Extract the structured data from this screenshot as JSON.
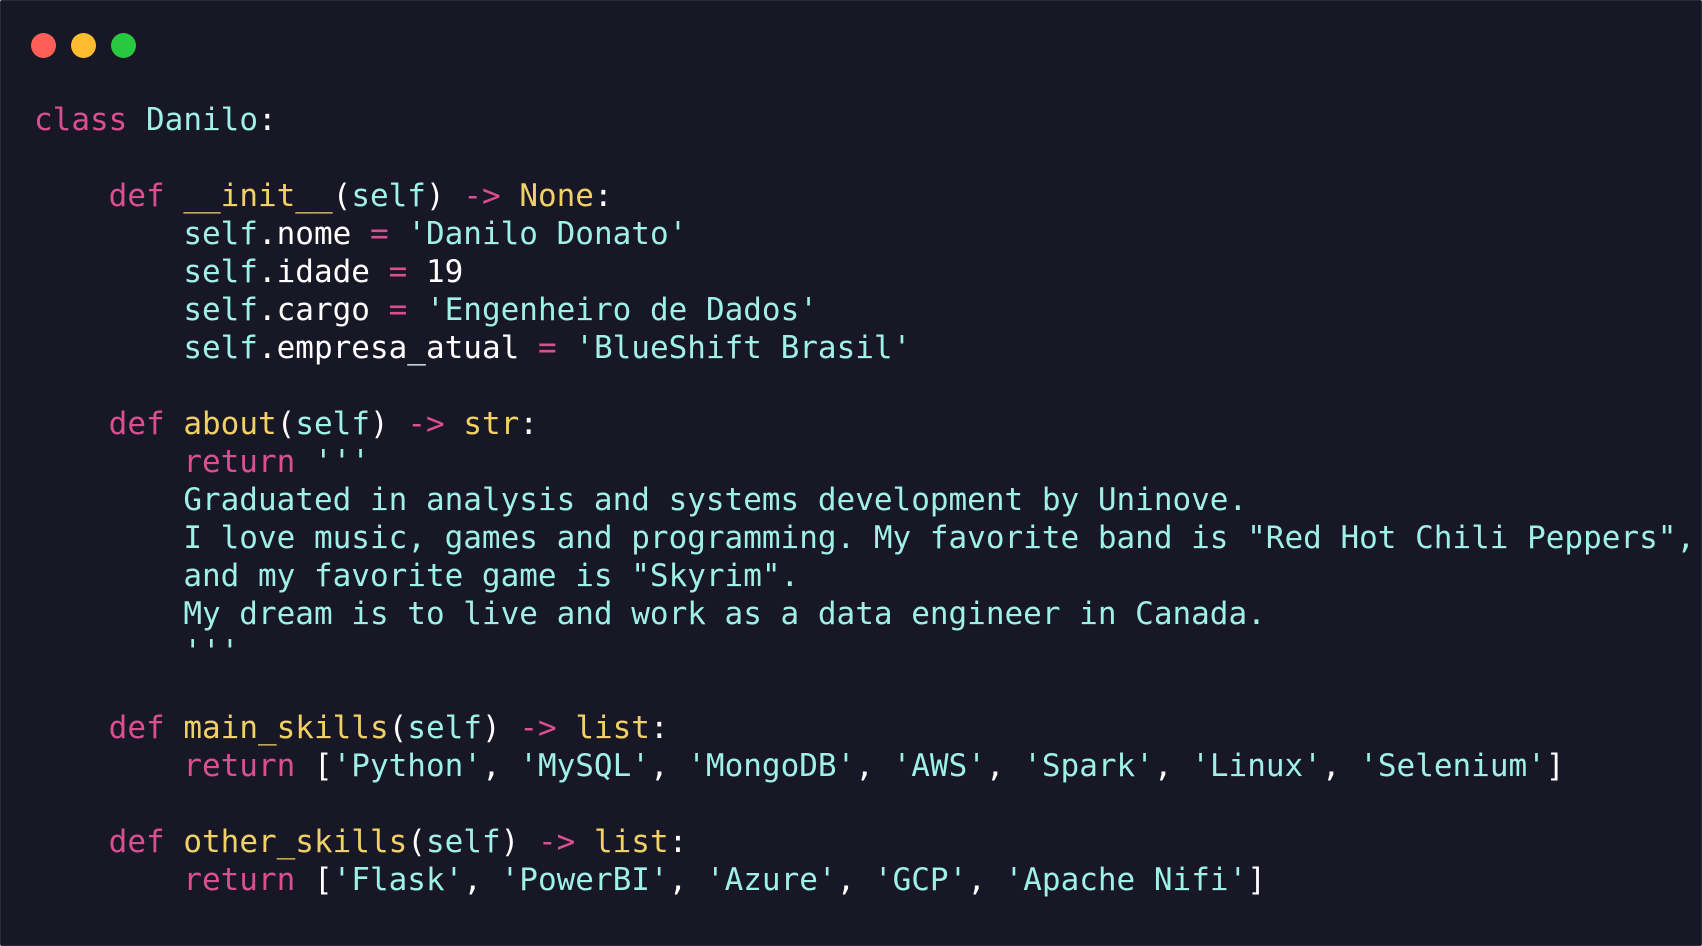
{
  "window": {
    "traffic_lights": [
      {
        "name": "close",
        "color": "#ff5f57"
      },
      {
        "name": "minimize",
        "color": "#febc2e"
      },
      {
        "name": "maximize",
        "color": "#28c840"
      }
    ]
  },
  "colors": {
    "background": "#171726",
    "keyword": "#d94f92",
    "function": "#f1d066",
    "text": "#9ff0e6",
    "punctuation": "#ffffff"
  },
  "code": {
    "language": "python",
    "lines": [
      [
        {
          "t": "keyword",
          "v": "class"
        },
        {
          "t": "text",
          "v": " "
        },
        {
          "t": "name",
          "v": "Danilo"
        },
        {
          "t": "punct",
          "v": ":"
        }
      ],
      [],
      [
        {
          "t": "text",
          "v": "    "
        },
        {
          "t": "keyword",
          "v": "def"
        },
        {
          "t": "text",
          "v": " "
        },
        {
          "t": "func",
          "v": "__init__"
        },
        {
          "t": "punct",
          "v": "("
        },
        {
          "t": "name",
          "v": "self"
        },
        {
          "t": "punct",
          "v": ")"
        },
        {
          "t": "text",
          "v": " "
        },
        {
          "t": "op",
          "v": "->"
        },
        {
          "t": "text",
          "v": " "
        },
        {
          "t": "type",
          "v": "None"
        },
        {
          "t": "punct",
          "v": ":"
        }
      ],
      [
        {
          "t": "text",
          "v": "        "
        },
        {
          "t": "name",
          "v": "self"
        },
        {
          "t": "punct",
          "v": "."
        },
        {
          "t": "punct",
          "v": "nome"
        },
        {
          "t": "text",
          "v": " "
        },
        {
          "t": "op",
          "v": "="
        },
        {
          "t": "text",
          "v": " "
        },
        {
          "t": "string",
          "v": "'Danilo Donato'"
        }
      ],
      [
        {
          "t": "text",
          "v": "        "
        },
        {
          "t": "name",
          "v": "self"
        },
        {
          "t": "punct",
          "v": "."
        },
        {
          "t": "punct",
          "v": "idade"
        },
        {
          "t": "text",
          "v": " "
        },
        {
          "t": "op",
          "v": "="
        },
        {
          "t": "text",
          "v": " "
        },
        {
          "t": "number",
          "v": "19"
        }
      ],
      [
        {
          "t": "text",
          "v": "        "
        },
        {
          "t": "name",
          "v": "self"
        },
        {
          "t": "punct",
          "v": "."
        },
        {
          "t": "punct",
          "v": "cargo"
        },
        {
          "t": "text",
          "v": " "
        },
        {
          "t": "op",
          "v": "="
        },
        {
          "t": "text",
          "v": " "
        },
        {
          "t": "string",
          "v": "'Engenheiro de Dados'"
        }
      ],
      [
        {
          "t": "text",
          "v": "        "
        },
        {
          "t": "name",
          "v": "self"
        },
        {
          "t": "punct",
          "v": "."
        },
        {
          "t": "punct",
          "v": "empresa_atual"
        },
        {
          "t": "text",
          "v": " "
        },
        {
          "t": "op",
          "v": "="
        },
        {
          "t": "text",
          "v": " "
        },
        {
          "t": "string",
          "v": "'BlueShift Brasil'"
        }
      ],
      [],
      [
        {
          "t": "text",
          "v": "    "
        },
        {
          "t": "keyword",
          "v": "def"
        },
        {
          "t": "text",
          "v": " "
        },
        {
          "t": "func",
          "v": "about"
        },
        {
          "t": "punct",
          "v": "("
        },
        {
          "t": "name",
          "v": "self"
        },
        {
          "t": "punct",
          "v": ")"
        },
        {
          "t": "text",
          "v": " "
        },
        {
          "t": "op",
          "v": "->"
        },
        {
          "t": "text",
          "v": " "
        },
        {
          "t": "type",
          "v": "str"
        },
        {
          "t": "punct",
          "v": ":"
        }
      ],
      [
        {
          "t": "text",
          "v": "        "
        },
        {
          "t": "keyword",
          "v": "return"
        },
        {
          "t": "text",
          "v": " "
        },
        {
          "t": "string",
          "v": "'''"
        }
      ],
      [
        {
          "t": "text",
          "v": "        "
        },
        {
          "t": "string",
          "v": "Graduated in analysis and systems development by Uninove."
        }
      ],
      [
        {
          "t": "text",
          "v": "        "
        },
        {
          "t": "string",
          "v": "I love music, games and programming. My favorite band is \"Red Hot Chili Peppers\","
        }
      ],
      [
        {
          "t": "text",
          "v": "        "
        },
        {
          "t": "string",
          "v": "and my favorite game is \"Skyrim\"."
        }
      ],
      [
        {
          "t": "text",
          "v": "        "
        },
        {
          "t": "string",
          "v": "My dream is to live and work as a data engineer in Canada."
        }
      ],
      [
        {
          "t": "text",
          "v": "        "
        },
        {
          "t": "string",
          "v": "'''"
        }
      ],
      [],
      [
        {
          "t": "text",
          "v": "    "
        },
        {
          "t": "keyword",
          "v": "def"
        },
        {
          "t": "text",
          "v": " "
        },
        {
          "t": "func",
          "v": "main_skills"
        },
        {
          "t": "punct",
          "v": "("
        },
        {
          "t": "name",
          "v": "self"
        },
        {
          "t": "punct",
          "v": ")"
        },
        {
          "t": "text",
          "v": " "
        },
        {
          "t": "op",
          "v": "->"
        },
        {
          "t": "text",
          "v": " "
        },
        {
          "t": "type",
          "v": "list"
        },
        {
          "t": "punct",
          "v": ":"
        }
      ],
      [
        {
          "t": "text",
          "v": "        "
        },
        {
          "t": "keyword",
          "v": "return"
        },
        {
          "t": "text",
          "v": " "
        },
        {
          "t": "punct",
          "v": "["
        },
        {
          "t": "string",
          "v": "'Python'"
        },
        {
          "t": "punct",
          "v": ", "
        },
        {
          "t": "string",
          "v": "'MySQL'"
        },
        {
          "t": "punct",
          "v": ", "
        },
        {
          "t": "string",
          "v": "'MongoDB'"
        },
        {
          "t": "punct",
          "v": ", "
        },
        {
          "t": "string",
          "v": "'AWS'"
        },
        {
          "t": "punct",
          "v": ", "
        },
        {
          "t": "string",
          "v": "'Spark'"
        },
        {
          "t": "punct",
          "v": ", "
        },
        {
          "t": "string",
          "v": "'Linux'"
        },
        {
          "t": "punct",
          "v": ", "
        },
        {
          "t": "string",
          "v": "'Selenium'"
        },
        {
          "t": "punct",
          "v": "]"
        }
      ],
      [],
      [
        {
          "t": "text",
          "v": "    "
        },
        {
          "t": "keyword",
          "v": "def"
        },
        {
          "t": "text",
          "v": " "
        },
        {
          "t": "func",
          "v": "other_skills"
        },
        {
          "t": "punct",
          "v": "("
        },
        {
          "t": "name",
          "v": "self"
        },
        {
          "t": "punct",
          "v": ")"
        },
        {
          "t": "text",
          "v": " "
        },
        {
          "t": "op",
          "v": "->"
        },
        {
          "t": "text",
          "v": " "
        },
        {
          "t": "type",
          "v": "list"
        },
        {
          "t": "punct",
          "v": ":"
        }
      ],
      [
        {
          "t": "text",
          "v": "        "
        },
        {
          "t": "keyword",
          "v": "return"
        },
        {
          "t": "text",
          "v": " "
        },
        {
          "t": "punct",
          "v": "["
        },
        {
          "t": "string",
          "v": "'Flask'"
        },
        {
          "t": "punct",
          "v": ", "
        },
        {
          "t": "string",
          "v": "'PowerBI'"
        },
        {
          "t": "punct",
          "v": ", "
        },
        {
          "t": "string",
          "v": "'Azure'"
        },
        {
          "t": "punct",
          "v": ", "
        },
        {
          "t": "string",
          "v": "'GCP'"
        },
        {
          "t": "punct",
          "v": ", "
        },
        {
          "t": "string",
          "v": "'Apache Nifi'"
        },
        {
          "t": "punct",
          "v": "]"
        }
      ]
    ]
  }
}
